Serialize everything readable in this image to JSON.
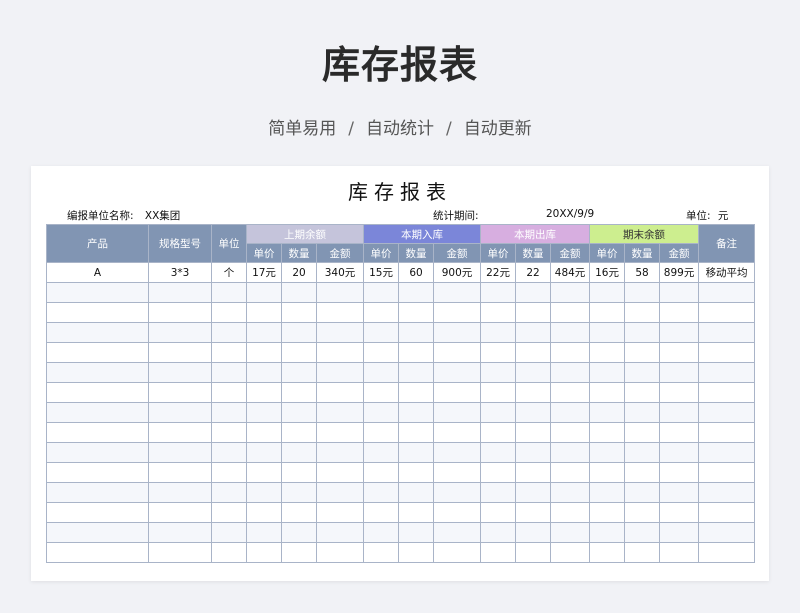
{
  "hero": {
    "title": "库存报表",
    "tags": [
      "简单易用",
      "自动统计",
      "自动更新"
    ],
    "separator": "/"
  },
  "sheet": {
    "title": "库存报表",
    "meta": {
      "unit_name_label": "编报单位名称:",
      "unit_name_value": "XX集团",
      "period_label": "统计期间:",
      "period_value": "20XX/9/9",
      "currency_label": "单位:",
      "currency_value": "元"
    },
    "headers": {
      "product": "产品",
      "spec": "规格型号",
      "unit": "单位",
      "opening": "上期余额",
      "in": "本期入库",
      "out": "本期出库",
      "closing": "期末余额",
      "remark": "备注",
      "sub": [
        "单价",
        "数量",
        "金额"
      ]
    },
    "rows": [
      [
        "A",
        "3*3",
        "个",
        "17元",
        "20",
        "340元",
        "15元",
        "60",
        "900元",
        "22元",
        "22",
        "484元",
        "16元",
        "58",
        "899元",
        "移动平均"
      ]
    ],
    "empty_row_count": 14
  }
}
